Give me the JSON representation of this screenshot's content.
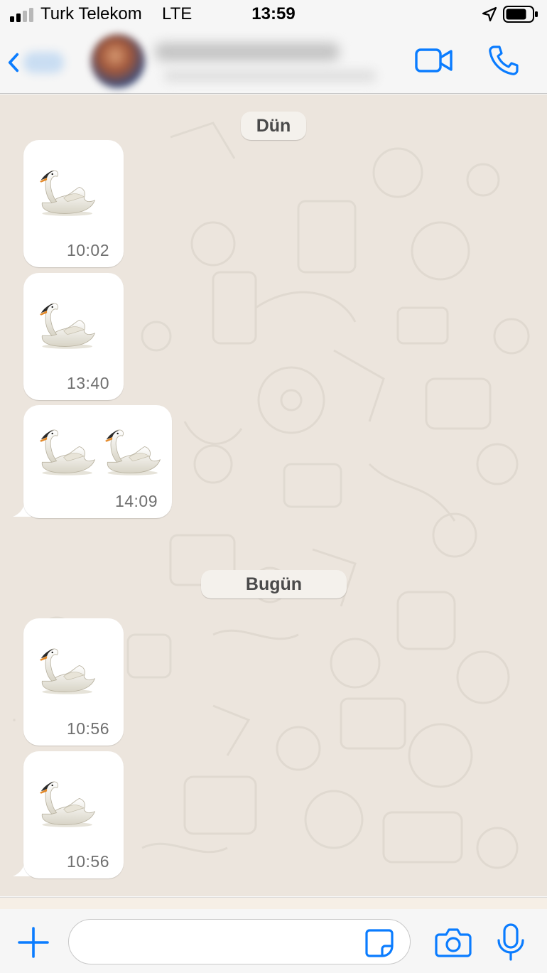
{
  "status_bar": {
    "carrier": "Turk Telekom",
    "network": "LTE",
    "time": "13:59",
    "icons": [
      "signal-icon",
      "location-arrow-icon",
      "battery-icon"
    ]
  },
  "header": {
    "contact_name": "",
    "icons": [
      "back-chevron-icon",
      "video-call-icon",
      "voice-call-icon"
    ],
    "accent_color": "#0a7cff"
  },
  "chat": {
    "date_separators": [
      "Dün",
      "Bugün"
    ],
    "messages": [
      {
        "content": "🦢",
        "time": "10:02"
      },
      {
        "content": "🦢",
        "time": "13:40"
      },
      {
        "content": "🦢🦢",
        "time": "14:09"
      },
      {
        "content": "🦢",
        "time": "10:56"
      },
      {
        "content": "🦢",
        "time": "10:56"
      }
    ]
  },
  "input_bar": {
    "message_placeholder": "",
    "icons": [
      "plus-icon",
      "sticker-icon",
      "camera-icon",
      "microphone-icon"
    ]
  }
}
